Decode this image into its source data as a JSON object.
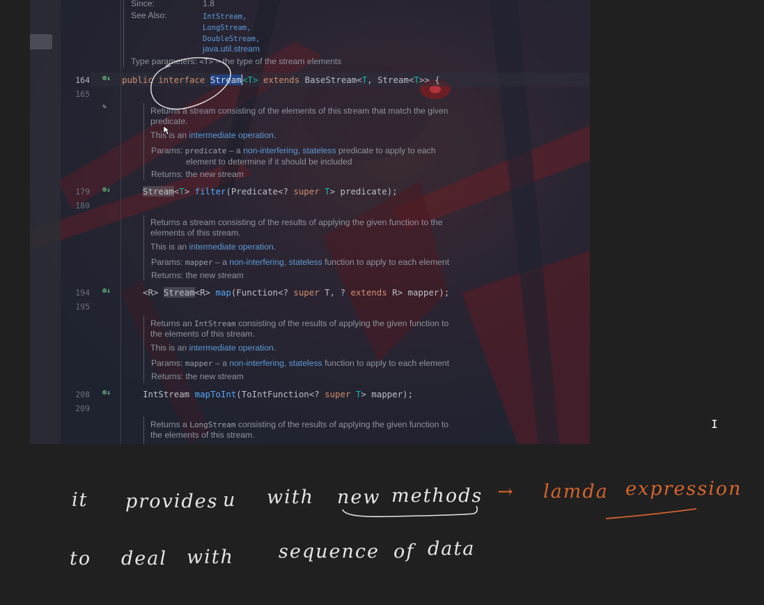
{
  "colors": {
    "background": "#202020",
    "editor_bg": "#262834",
    "keyword": "#cf8e6d",
    "type_param": "#16baac",
    "function": "#56a8f5",
    "link": "#5c9bd6",
    "ink_white": "#e6e6e6",
    "ink_orange": "#d4652e",
    "gutter_icon": "#6ec285"
  },
  "header_doc": {
    "since_label": "Since:",
    "since_value": "1.8",
    "see_also_label": "See Also:",
    "see_also_links": [
      "IntStream,",
      "LongStream,",
      "DoubleStream,",
      "java.util.stream"
    ],
    "type_params_label": "Type parameters:",
    "type_params_code": "<T>",
    "type_params_text": " – the type of the stream elements"
  },
  "editor": {
    "interface_line": {
      "number": "164",
      "icon": "implemented-icon",
      "kw_public": "public ",
      "kw_interface": "interface ",
      "name": "Stream",
      "t1": "<T>",
      "kw_extends": " extends ",
      "base": "BaseStream<",
      "t2": "T",
      "base2": ", Stream<",
      "t3": "T",
      "end": ">> {"
    },
    "line_165": "165",
    "doc_filter": {
      "line1": "Returns a stream consisting of the elements of this stream that match the given",
      "line2": "predicate.",
      "op_prefix": "This is an ",
      "op_link": "intermediate operation",
      "op_suffix": ".",
      "params_label": "Params: ",
      "param_name": "predicate",
      "param_dash": " – a ",
      "param_link1": "non-interfering",
      "param_sep": ", ",
      "param_link2": "stateless",
      "param_rest1": " predicate to apply to each",
      "param_rest2": "element to determine if it should be included",
      "returns": "Returns: the new stream"
    },
    "filter_line": {
      "number": "179",
      "icon": "implemented-icon",
      "type": "Stream",
      "lt": "<",
      "t": "T",
      "gt": "> ",
      "name": "filter",
      "args_a": "(Predicate<? ",
      "kw_super": "super",
      "args_b": " ",
      "t2": "T",
      "args_c": "> predicate);"
    },
    "line_180": "180",
    "doc_map": {
      "line1": "Returns a stream consisting of the results of applying the given function to the",
      "line2": "elements of this stream.",
      "op_prefix": "This is an ",
      "op_link": "intermediate operation",
      "op_suffix": ".",
      "params_label": "Params: ",
      "param_name": "mapper",
      "param_dash": " – a ",
      "param_link1": "non-interfering",
      "param_sep": ", ",
      "param_link2": "stateless",
      "param_rest": " function to apply to each element",
      "returns": "Returns: the new stream"
    },
    "map_line": {
      "number": "194",
      "icon": "implemented-icon",
      "r1": "<R> ",
      "type": "Stream",
      "r2": "<R> ",
      "name": "map",
      "args_a": "(Function<? ",
      "kw_super": "super",
      "args_b": " T, ? ",
      "kw_extends": "extends",
      "args_c": " R> mapper);"
    },
    "line_195": "195",
    "doc_maptoint": {
      "line1_prefix": "Returns an ",
      "line1_code": "IntStream",
      "line1_rest": " consisting of the results of applying the given function to",
      "line2": "the elements of this stream.",
      "op_prefix": "This is an ",
      "op_link": "intermediate operation",
      "op_suffix": ".",
      "params_label": "Params: ",
      "param_name": "mapper",
      "param_dash": " – a ",
      "param_link1": "non-interfering",
      "param_sep": ", ",
      "param_link2": "stateless",
      "param_rest": " function to apply to each element",
      "returns": "Returns: the new stream"
    },
    "maptoint_line": {
      "number": "208",
      "icon": "implemented-icon",
      "type": "IntStream ",
      "name": "mapToInt",
      "args_a": "(ToIntFunction<? ",
      "kw_super": "super",
      "args_b": " ",
      "t": "T",
      "args_c": "> mapper);"
    },
    "line_209": "209",
    "doc_maptolong": {
      "line1_prefix": "Returns a ",
      "line1_code": "LongStream",
      "line1_rest": " consisting of the results of applying the given function to",
      "line2": "the elements of this stream."
    }
  },
  "handwriting": {
    "line1_words": [
      "it",
      "provides",
      "u",
      "with",
      "new",
      "methods"
    ],
    "arrow": "→",
    "orange_words": [
      "lamda",
      "expression"
    ],
    "line2_words": [
      "to",
      "deal",
      "with",
      "sequence",
      "of",
      "data"
    ]
  },
  "cursor": "I"
}
